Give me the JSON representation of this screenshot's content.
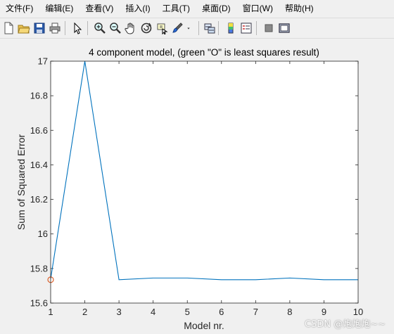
{
  "menu": [
    {
      "label": "文件(F)"
    },
    {
      "label": "编辑(E)"
    },
    {
      "label": "查看(V)"
    },
    {
      "label": "插入(I)"
    },
    {
      "label": "工具(T)"
    },
    {
      "label": "桌面(D)"
    },
    {
      "label": "窗口(W)"
    },
    {
      "label": "帮助(H)"
    }
  ],
  "toolbar": [
    {
      "icon": "new-file-icon"
    },
    {
      "icon": "open-folder-icon"
    },
    {
      "icon": "save-icon"
    },
    {
      "icon": "print-icon"
    },
    {
      "icon": "pointer-icon"
    },
    {
      "icon": "zoom-in-icon"
    },
    {
      "icon": "zoom-out-icon"
    },
    {
      "icon": "pan-hand-icon"
    },
    {
      "icon": "rotate-3d-icon"
    },
    {
      "icon": "data-cursor-icon"
    },
    {
      "icon": "brush-icon"
    },
    {
      "icon": "brush-dropdown-icon"
    },
    {
      "icon": "link-plot-icon"
    },
    {
      "icon": "colorbar-icon"
    },
    {
      "icon": "legend-icon"
    },
    {
      "icon": "hide-plot-tools-icon"
    },
    {
      "icon": "show-plot-tools-icon"
    }
  ],
  "colors": {
    "line": "#0072bd",
    "marker": "#d95319",
    "axes_bg": "#ffffff",
    "figure_bg": "#f0f0f0"
  },
  "chart_data": {
    "type": "line",
    "title": "4 component model, (green \"O\" is least squares result)",
    "xlabel": "Model nr.",
    "ylabel": "Sum of Squared Error",
    "x": [
      1,
      2,
      3,
      4,
      5,
      6,
      7,
      8,
      9,
      10
    ],
    "series": [
      {
        "values": [
          15.74,
          17.0,
          15.735,
          15.745,
          15.745,
          15.735,
          15.735,
          15.745,
          15.735,
          15.735
        ]
      }
    ],
    "markers": [
      {
        "x": 1,
        "y": 15.735,
        "shape": "circle"
      }
    ],
    "xlim": [
      1,
      10
    ],
    "ylim": [
      15.6,
      17.0
    ],
    "xticks": [
      1,
      2,
      3,
      4,
      5,
      6,
      7,
      8,
      9,
      10
    ],
    "xtick_labels": [
      "1",
      "2",
      "3",
      "4",
      "5",
      "6",
      "7",
      "8",
      "9",
      "10"
    ],
    "yticks": [
      15.6,
      15.8,
      16.0,
      16.2,
      16.4,
      16.6,
      16.8,
      17.0
    ],
    "ytick_labels": [
      "15.6",
      "15.8",
      "16",
      "16.2",
      "16.4",
      "16.6",
      "16.8",
      "17"
    ],
    "grid": false,
    "legend": false
  },
  "watermark": "CSDN @炮炮炮~~"
}
